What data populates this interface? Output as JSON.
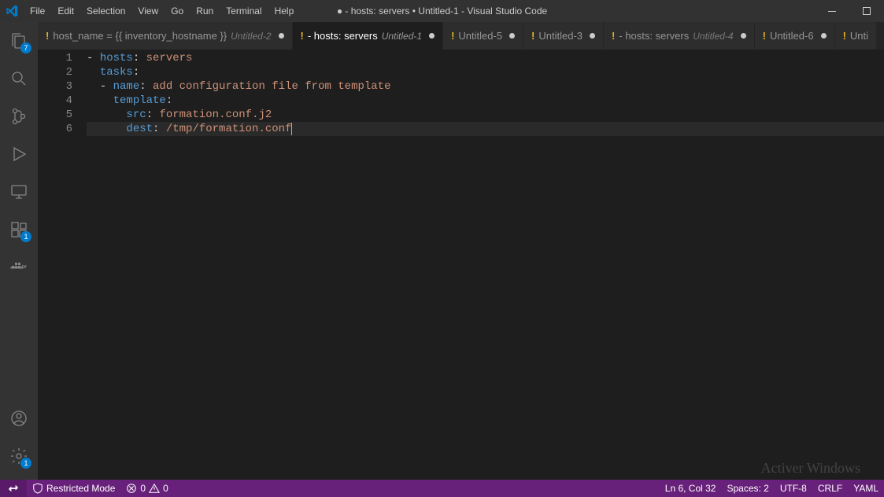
{
  "title": "● - hosts: servers • Untitled-1 - Visual Studio Code",
  "menu": [
    "File",
    "Edit",
    "Selection",
    "View",
    "Go",
    "Run",
    "Terminal",
    "Help"
  ],
  "activity": {
    "explorer_badge": "7",
    "extensions_badge": "1",
    "settings_badge": "1"
  },
  "tabs": [
    {
      "icon": "!",
      "label": "host_name = {{ inventory_hostname }}",
      "desc": "Untitled-2",
      "modified": true,
      "active": false
    },
    {
      "icon": "!",
      "label": "- hosts: servers",
      "desc": "Untitled-1",
      "modified": true,
      "active": true
    },
    {
      "icon": "!",
      "label": "Untitled-5",
      "desc": "",
      "modified": true,
      "active": false
    },
    {
      "icon": "!",
      "label": "Untitled-3",
      "desc": "",
      "modified": true,
      "active": false
    },
    {
      "icon": "!",
      "label": "- hosts: servers",
      "desc": "Untitled-4",
      "modified": true,
      "active": false
    },
    {
      "icon": "!",
      "label": "Untitled-6",
      "desc": "",
      "modified": true,
      "active": false
    },
    {
      "icon": "!",
      "label": "Unti",
      "desc": "",
      "modified": false,
      "active": false
    }
  ],
  "code_lines": [
    {
      "n": "1",
      "tokens": [
        [
          "plain",
          "- "
        ],
        [
          "key",
          "hosts"
        ],
        [
          "plain",
          ": "
        ],
        [
          "str",
          "servers"
        ]
      ]
    },
    {
      "n": "2",
      "tokens": [
        [
          "plain",
          "  "
        ],
        [
          "key",
          "tasks"
        ],
        [
          "plain",
          ":"
        ]
      ]
    },
    {
      "n": "3",
      "tokens": [
        [
          "plain",
          "  - "
        ],
        [
          "key",
          "name"
        ],
        [
          "plain",
          ": "
        ],
        [
          "str",
          "add configuration file from template"
        ]
      ]
    },
    {
      "n": "4",
      "tokens": [
        [
          "plain",
          "    "
        ],
        [
          "key",
          "template"
        ],
        [
          "plain",
          ":"
        ]
      ]
    },
    {
      "n": "5",
      "tokens": [
        [
          "plain",
          "      "
        ],
        [
          "key",
          "src"
        ],
        [
          "plain",
          ": "
        ],
        [
          "str",
          "formation.conf.j2"
        ]
      ]
    },
    {
      "n": "6",
      "tokens": [
        [
          "plain",
          "      "
        ],
        [
          "key",
          "dest"
        ],
        [
          "plain",
          ": "
        ],
        [
          "str",
          "/tmp/formation.conf"
        ]
      ]
    }
  ],
  "current_line": 6,
  "status": {
    "restricted": "Restricted Mode",
    "errors": "0",
    "warnings": "0",
    "cursor": "Ln 6, Col 32",
    "spaces": "Spaces: 2",
    "encoding": "UTF-8",
    "eol": "CRLF",
    "lang": "YAML"
  },
  "watermark": "Activer Windows"
}
